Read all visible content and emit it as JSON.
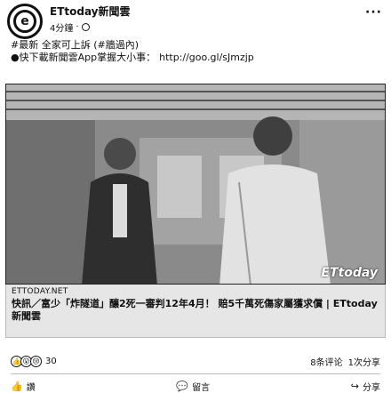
{
  "header": {
    "page_name": "ETtoday新聞雲",
    "time": "4分鐘",
    "separator": "·"
  },
  "post": {
    "line1": "#最新 全家可上訴 (#牆過內)",
    "line2_prefix": "●快下載新聞雲App掌握大小事：",
    "link": "http://goo.gl/sJmzjp"
  },
  "photo": {
    "watermark": "ETtoday"
  },
  "preview": {
    "domain": "ETTODAY.NET",
    "headline": "快訊／富少「炸隧道」釀2死一審判12年4月！ 賠5千萬死傷家屬獲求償 | ETtoday新聞雲"
  },
  "stats": {
    "reaction_count": "30",
    "comments": "8条评论",
    "shares": "1次分享"
  },
  "actions": {
    "like": "讚",
    "comment": "留言",
    "share": "分享"
  },
  "colors": {
    "photo_bg": "#7d7d7d",
    "preview_bg": "#e6e6e6"
  }
}
